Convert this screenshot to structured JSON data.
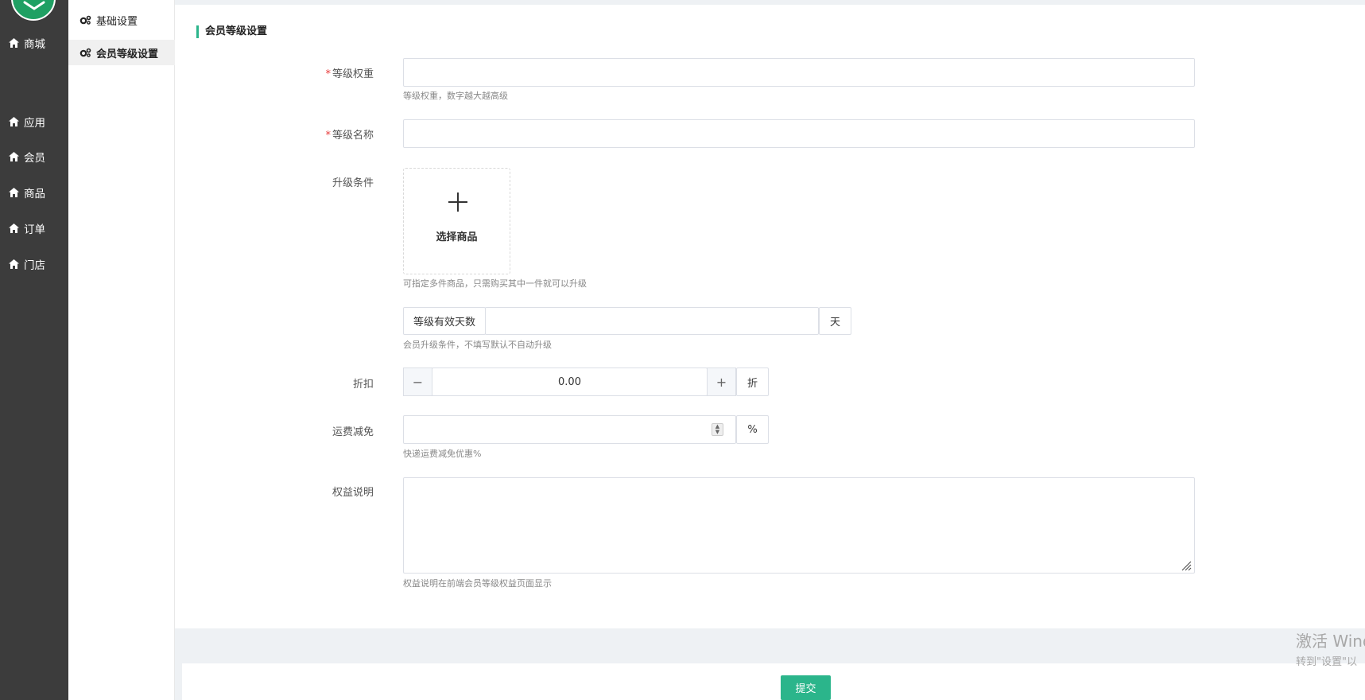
{
  "nav": {
    "items": [
      {
        "label": "商城",
        "icon": "home-icon"
      },
      {
        "label": "应用",
        "icon": "home-icon"
      },
      {
        "label": "会员",
        "icon": "home-icon"
      },
      {
        "label": "商品",
        "icon": "home-icon"
      },
      {
        "label": "订单",
        "icon": "home-icon"
      },
      {
        "label": "门店",
        "icon": "home-icon"
      }
    ]
  },
  "subnav": {
    "items": [
      {
        "label": "基础设置",
        "icon": "gears-icon",
        "active": false
      },
      {
        "label": "会员等级设置",
        "icon": "gears-icon",
        "active": true
      }
    ]
  },
  "form": {
    "section_title": "会员等级设置",
    "weight": {
      "label": "等级权重",
      "required_mark": "*",
      "value": "",
      "help": "等级权重，数字越大越高级"
    },
    "name": {
      "label": "等级名称",
      "required_mark": "*",
      "value": ""
    },
    "upgrade": {
      "label": "升级条件",
      "select_label": "选择商品",
      "help": "可指定多件商品，只需购买其中一件就可以升级"
    },
    "valid_days": {
      "prefix": "等级有效天数",
      "value": "",
      "suffix": "天",
      "help": "会员升级条件，不填写默认不自动升级"
    },
    "discount": {
      "label": "折扣",
      "value": "0.00",
      "minus": "−",
      "plus": "+",
      "suffix": "折"
    },
    "shipping": {
      "label": "运费减免",
      "value": "",
      "suffix": "%",
      "help": "快递运费减免优惠%"
    },
    "benefits": {
      "label": "权益说明",
      "value": "",
      "help": "权益说明在前端会员等级权益页面显示"
    },
    "submit_label": "提交"
  },
  "watermark": {
    "line1": "激活 Wind",
    "line2": "转到\"设置\"以"
  },
  "colors": {
    "accent": "#2bb58b",
    "nav_bg": "#3c3c3c",
    "required": "#e83a3a"
  }
}
